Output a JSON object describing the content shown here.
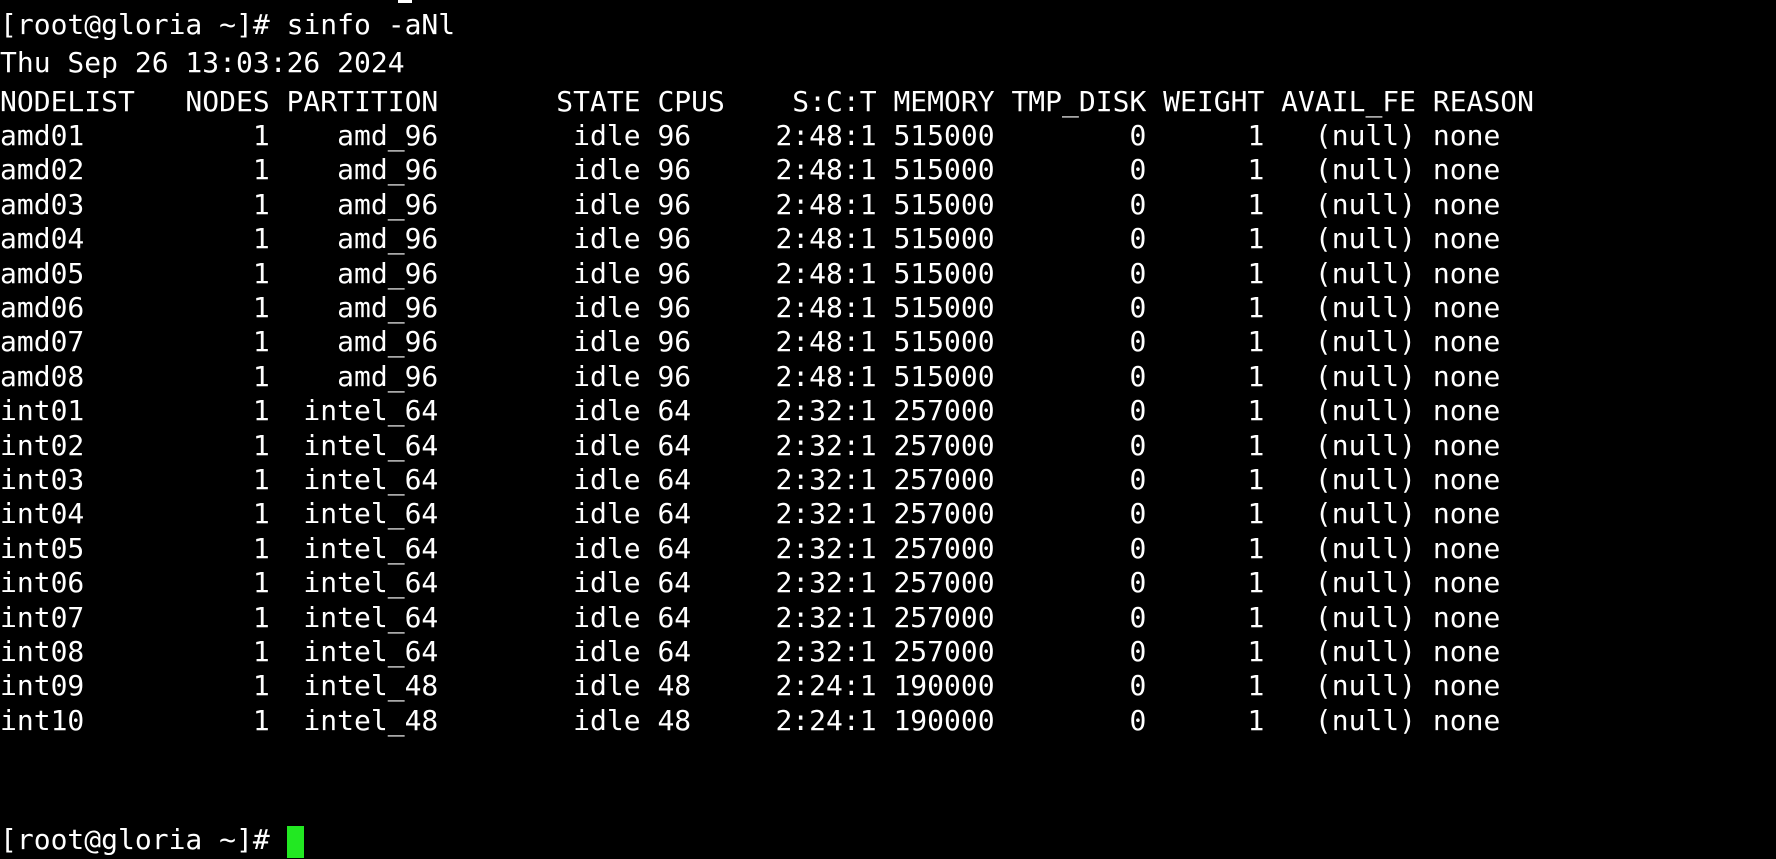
{
  "terminal": {
    "command_line": "[root@gloria ~]# sinfo -aNl",
    "timestamp": "Thu Sep 26 13:03:26 2024",
    "header": "NODELIST   NODES PARTITION       STATE CPUS    S:C:T MEMORY TMP_DISK WEIGHT AVAIL_FE REASON",
    "rows": [
      "amd01          1    amd_96        idle 96     2:48:1 515000        0      1   (null) none",
      "amd02          1    amd_96        idle 96     2:48:1 515000        0      1   (null) none",
      "amd03          1    amd_96        idle 96     2:48:1 515000        0      1   (null) none",
      "amd04          1    amd_96        idle 96     2:48:1 515000        0      1   (null) none",
      "amd05          1    amd_96        idle 96     2:48:1 515000        0      1   (null) none",
      "amd06          1    amd_96        idle 96     2:48:1 515000        0      1   (null) none",
      "amd07          1    amd_96        idle 96     2:48:1 515000        0      1   (null) none",
      "amd08          1    amd_96        idle 96     2:48:1 515000        0      1   (null) none",
      "int01          1  intel_64        idle 64     2:32:1 257000        0      1   (null) none",
      "int02          1  intel_64        idle 64     2:32:1 257000        0      1   (null) none",
      "int03          1  intel_64        idle 64     2:32:1 257000        0      1   (null) none",
      "int04          1  intel_64        idle 64     2:32:1 257000        0      1   (null) none",
      "int05          1  intel_64        idle 64     2:32:1 257000        0      1   (null) none",
      "int06          1  intel_64        idle 64     2:32:1 257000        0      1   (null) none",
      "int07          1  intel_64        idle 64     2:32:1 257000        0      1   (null) none",
      "int08          1  intel_64        idle 64     2:32:1 257000        0      1   (null) none",
      "int09          1  intel_48        idle 48     2:24:1 190000        0      1   (null) none",
      "int10          1  intel_48        idle 48     2:24:1 190000        0      1   (null) none"
    ],
    "prompt": "[root@gloria ~]# ",
    "cursor_color": "#22e822",
    "background_color": "#000000",
    "text_color": "#ffffff"
  }
}
